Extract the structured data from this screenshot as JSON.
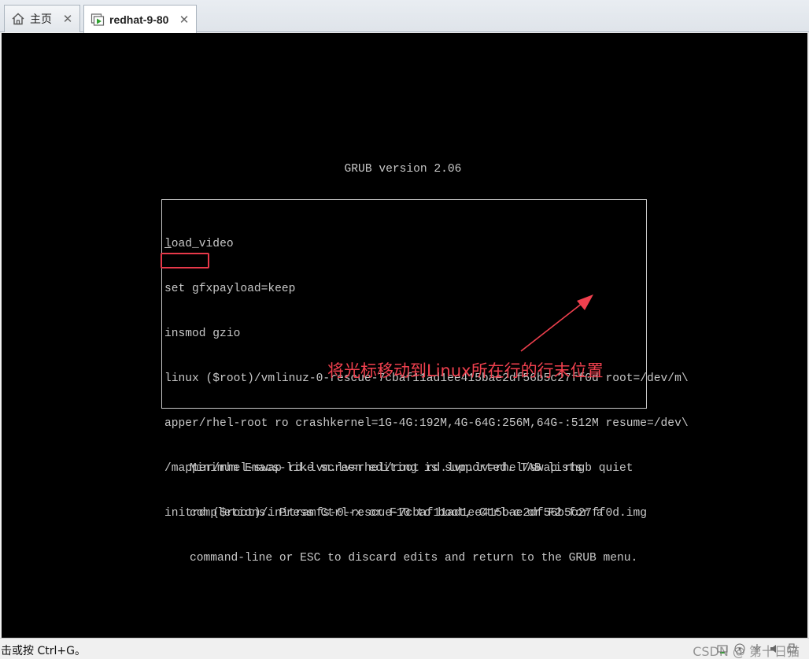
{
  "tabs": [
    {
      "label": "主页",
      "icon": "home-icon",
      "close": "✕"
    },
    {
      "label": "redhat-9-80",
      "icon": "vm-icon",
      "close": "✕"
    }
  ],
  "screen": {
    "grub_title": "GRUB version 2.06",
    "editor_lines": [
      "oad_video",
      "set gfxpayload=keep",
      "insmod gzio",
      "linux ($root)/vmlinuz-0-rescue-7cbaf11ad1ee415bae2df56b5c27ff0d root=/dev/m\\",
      "apper/rhel-root ro crashkernel=1G-4G:192M,4G-64G:256M,64G-:512M resume=/dev\\",
      "/mapper/rhel-swap rd.lvm.lv=rhel/root rd.lvm.lv=rhel/swap rhgb quiet",
      "initrd ($root)/initramfs-0-rescue-7cbaf11ad1ee415bae2df56b5c27ff0d.img"
    ],
    "cursor_char": "l",
    "help_lines": [
      "Minimum Emacs-like screen editing is supported. TAB lists",
      "completions. Press Ctrl-x or F10 to boot, Ctrl-c or F2 for a",
      "command-line or ESC to discard edits and return to the GRUB menu."
    ],
    "annotation": "将光标移动到Linux所在行的行末位置",
    "annotation_color": "#f0404e",
    "text_color": "#c8c8c8"
  },
  "status": {
    "message": "击或按 Ctrl+G。",
    "watermark": "CSDN @ 第十日猫"
  }
}
